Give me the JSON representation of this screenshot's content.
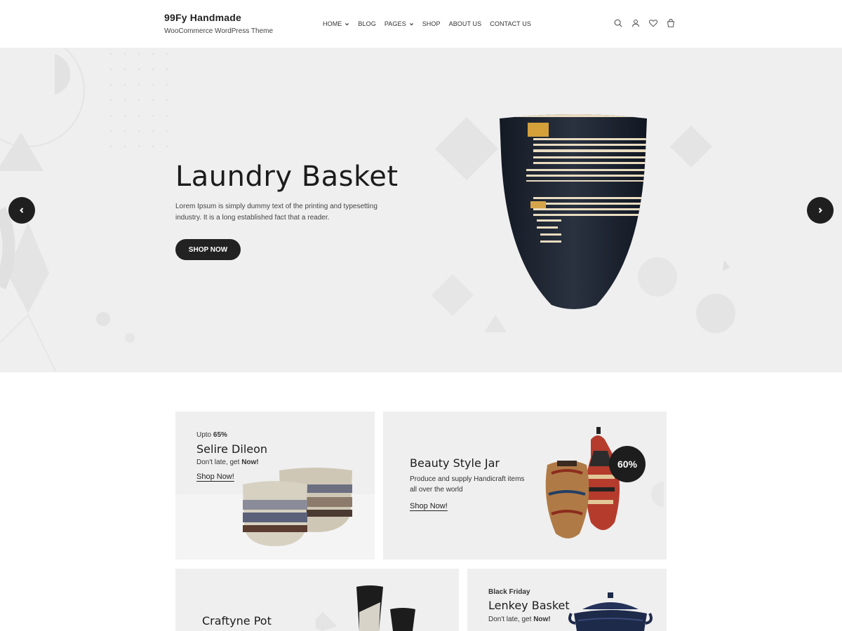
{
  "header": {
    "brand_name": "99Fy Handmade",
    "brand_tagline": "WooCommerce WordPress Theme",
    "nav": [
      {
        "label": "HOME",
        "has_dropdown": true
      },
      {
        "label": "BLOG",
        "has_dropdown": false
      },
      {
        "label": "PAGES",
        "has_dropdown": true
      },
      {
        "label": "SHOP",
        "has_dropdown": false
      },
      {
        "label": "ABOUT US",
        "has_dropdown": false
      },
      {
        "label": "CONTACT US",
        "has_dropdown": false
      }
    ],
    "icons": [
      "search-icon",
      "user-icon",
      "heart-icon",
      "bag-icon"
    ]
  },
  "hero": {
    "title": "Laundry Basket",
    "description": "Lorem Ipsum is simply dummy text of the printing and typesetting industry. It is a long established fact that a reader.",
    "button_label": "SHOP NOW"
  },
  "banners": {
    "b1": {
      "kicker_prefix": "Upto",
      "kicker_value": "65%",
      "title": "Selire Dileon",
      "sub_prefix": "Don't late, get",
      "sub_strong": "Now!",
      "link": "Shop Now!"
    },
    "b2": {
      "title": "Beauty Style Jar",
      "sub": "Produce and supply Handicraft items all over the world",
      "link": "Shop Now!",
      "badge": "60%"
    },
    "b3": {
      "title": "Craftyne Pot"
    },
    "b4": {
      "kicker": "Black Friday",
      "title": "Lenkey Basket",
      "sub_prefix": "Don't late, get",
      "sub_strong": "Now!"
    }
  },
  "colors": {
    "hero_bg": "#efefef",
    "dark": "#1f1f1f",
    "text": "#222222",
    "banner_bg": "#efefef"
  }
}
